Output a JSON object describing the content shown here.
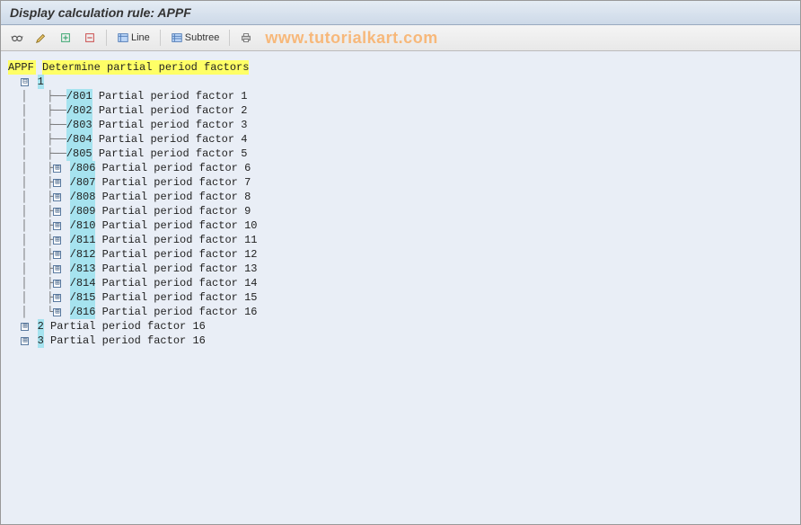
{
  "title": "Display calculation rule: APPF",
  "toolbar": {
    "line_label": "Line",
    "subtree_label": "Subtree"
  },
  "watermark": "www.tutorialkart.com",
  "tree": {
    "root_code": "APPF",
    "root_text": "Determine partial period factors",
    "node1": {
      "label": "1",
      "children": [
        {
          "code": "/801",
          "text": "Partial period factor 1",
          "expandable": false
        },
        {
          "code": "/802",
          "text": "Partial period factor 2",
          "expandable": false
        },
        {
          "code": "/803",
          "text": "Partial period factor 3",
          "expandable": false
        },
        {
          "code": "/804",
          "text": "Partial period factor 4",
          "expandable": false
        },
        {
          "code": "/805",
          "text": "Partial period factor 5",
          "expandable": false
        },
        {
          "code": "/806",
          "text": "Partial period factor 6",
          "expandable": true
        },
        {
          "code": "/807",
          "text": "Partial period factor 7",
          "expandable": true
        },
        {
          "code": "/808",
          "text": "Partial period factor 8",
          "expandable": true
        },
        {
          "code": "/809",
          "text": "Partial period factor 9",
          "expandable": true
        },
        {
          "code": "/810",
          "text": "Partial period factor 10",
          "expandable": true
        },
        {
          "code": "/811",
          "text": "Partial period factor 11",
          "expandable": true
        },
        {
          "code": "/812",
          "text": "Partial period factor 12",
          "expandable": true
        },
        {
          "code": "/813",
          "text": "Partial period factor 13",
          "expandable": true
        },
        {
          "code": "/814",
          "text": "Partial period factor 14",
          "expandable": true
        },
        {
          "code": "/815",
          "text": "Partial period factor 15",
          "expandable": true
        },
        {
          "code": "/816",
          "text": "Partial period factor 16",
          "expandable": true
        }
      ]
    },
    "node2": {
      "label": "2",
      "text": "Partial period factor 16"
    },
    "node3": {
      "label": "3",
      "text": "Partial period factor 16"
    }
  }
}
